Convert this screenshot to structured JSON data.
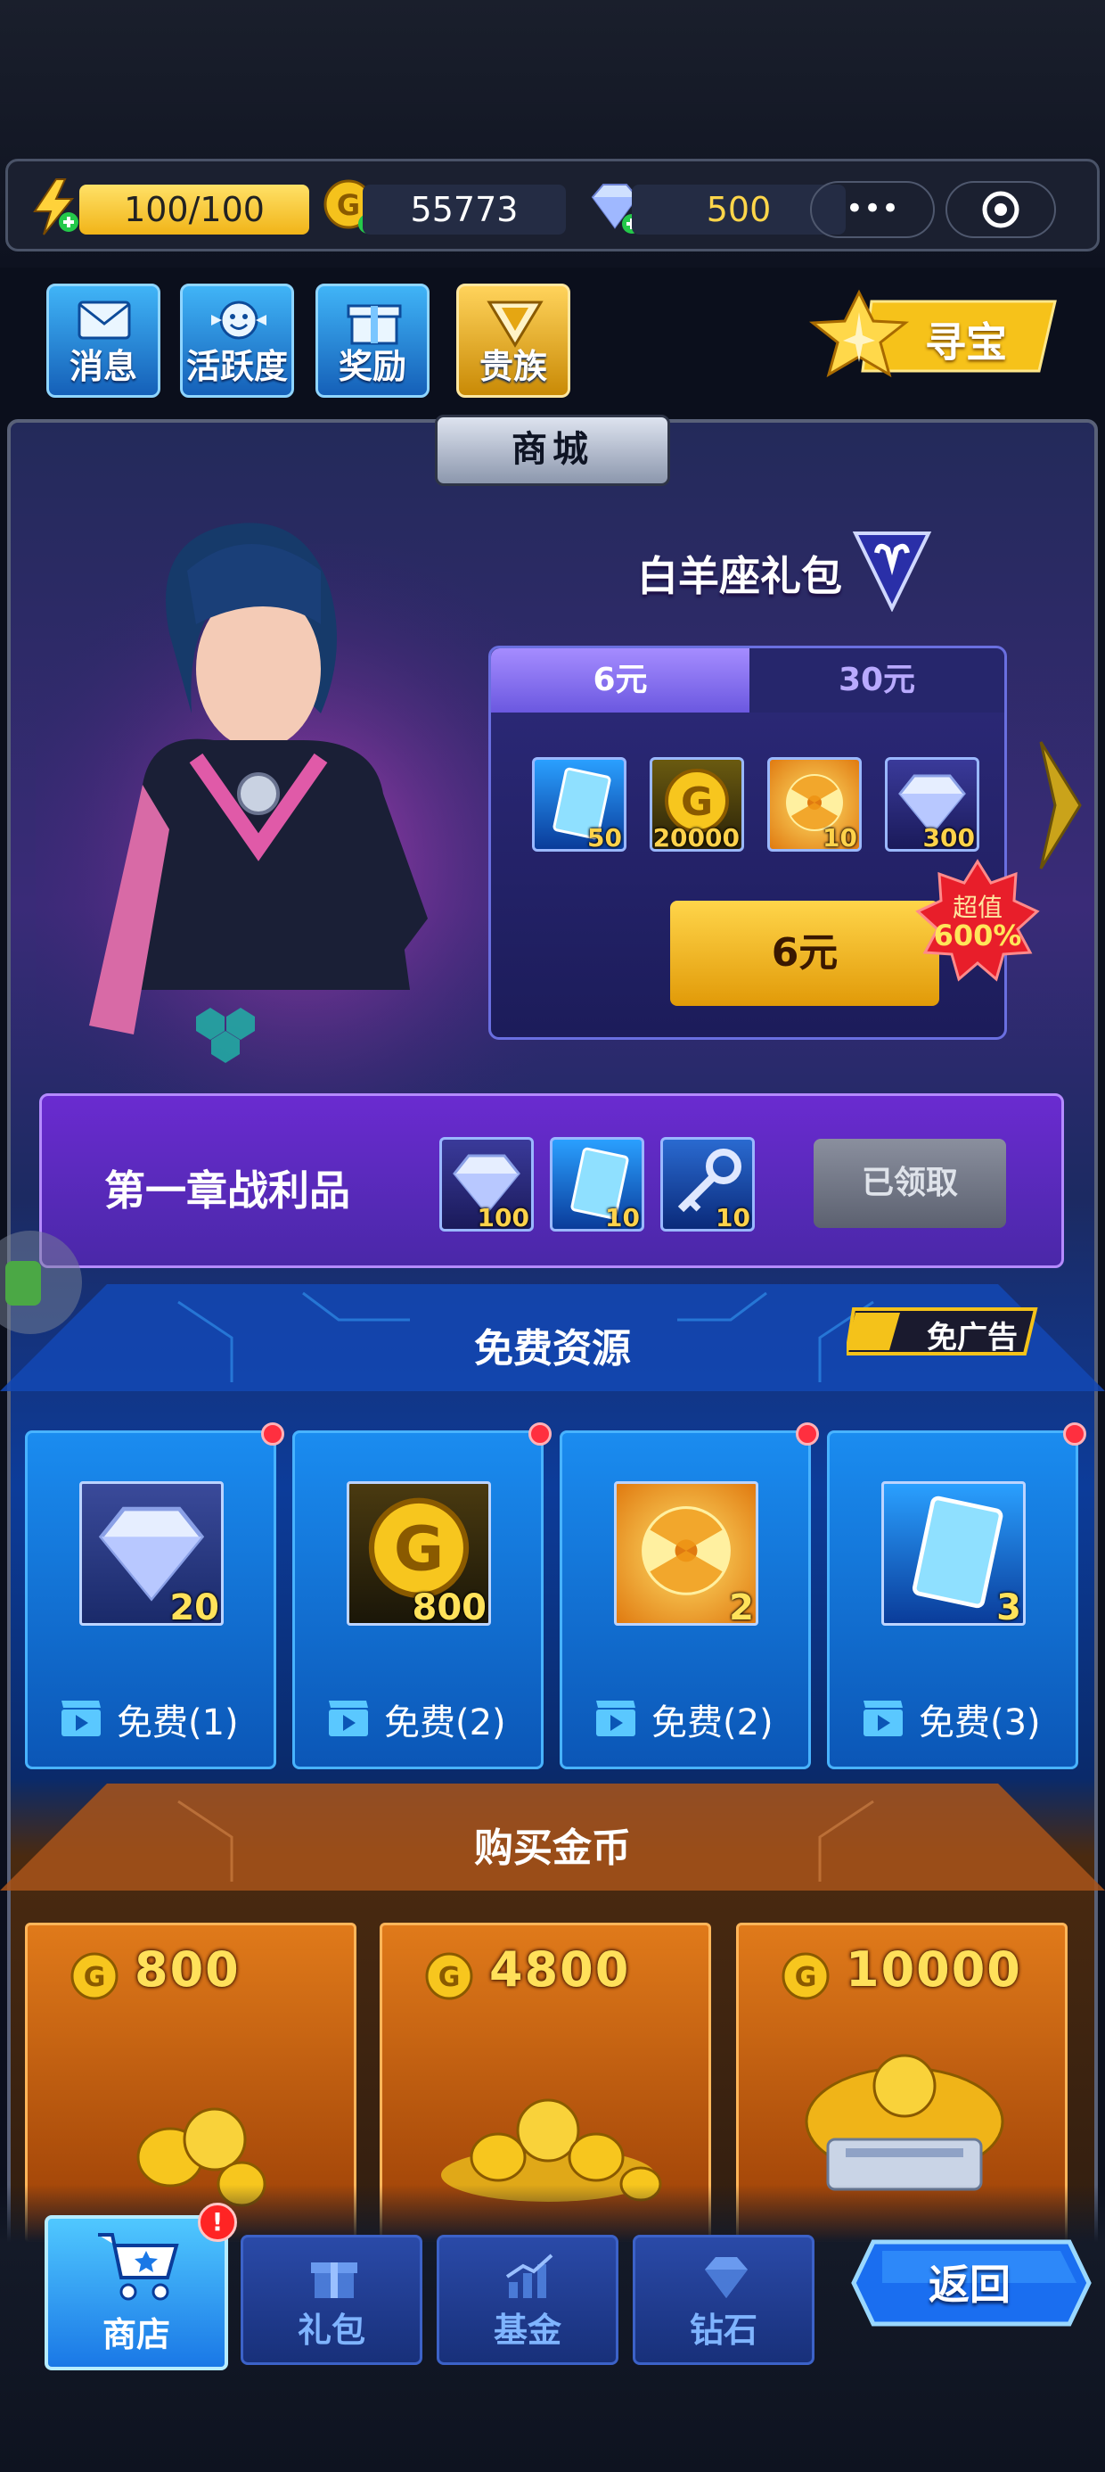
{
  "hud": {
    "energy": "100/100",
    "gold": "55773",
    "diamonds": "500",
    "more_label": "•••"
  },
  "top_buttons": [
    {
      "label": "消息"
    },
    {
      "label": "活跃度"
    },
    {
      "label": "奖励"
    },
    {
      "label": "贵族"
    }
  ],
  "treasure_label": "寻宝",
  "shop_title": "商城",
  "pack": {
    "title": "白羊座礼包",
    "tabs": [
      "6元",
      "30元"
    ],
    "items": [
      {
        "icon": "card-icon",
        "qty": "50"
      },
      {
        "icon": "gold-coin-icon",
        "qty": "20000"
      },
      {
        "icon": "radiation-icon",
        "qty": "10"
      },
      {
        "icon": "diamond-icon",
        "qty": "300"
      }
    ],
    "buy_label": "6元",
    "badge_line1": "超值",
    "badge_line2": "600%"
  },
  "chapter_loot": {
    "title": "第一章战利品",
    "items": [
      {
        "icon": "diamond-icon",
        "qty": "100"
      },
      {
        "icon": "card-icon",
        "qty": "10"
      },
      {
        "icon": "key-icon",
        "qty": "10"
      }
    ],
    "claimed_label": "已领取"
  },
  "free_resources": {
    "title": "免费资源",
    "no_ad_label": "免广告",
    "cards": [
      {
        "icon": "diamond-icon",
        "qty": "20",
        "label": "免费(1)"
      },
      {
        "icon": "gold-coin-icon",
        "qty": "800",
        "label": "免费(2)"
      },
      {
        "icon": "radiation-icon",
        "qty": "2",
        "label": "免费(2)"
      },
      {
        "icon": "card-icon",
        "qty": "3",
        "label": "免费(3)"
      }
    ]
  },
  "buy_gold": {
    "title": "购买金币",
    "packs": [
      {
        "amount": "800"
      },
      {
        "amount": "4800"
      },
      {
        "amount": "10000"
      }
    ]
  },
  "bottom_nav": {
    "items": [
      {
        "label": "商店",
        "badge": "!"
      },
      {
        "label": "礼包"
      },
      {
        "label": "基金"
      },
      {
        "label": "钻石"
      }
    ],
    "back_label": "返回"
  },
  "colors": {
    "accent_blue": "#1a8cf0",
    "gold": "#ffd54a",
    "purple": "#6a2bd0",
    "orange": "#e07a1a"
  }
}
